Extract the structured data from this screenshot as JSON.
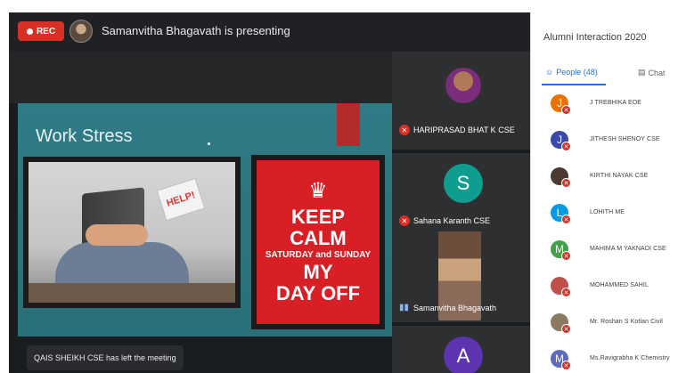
{
  "recording": {
    "label": "REC",
    "presenter_text": "Samanvitha Bhagavath is presenting"
  },
  "slide": {
    "title": "Work Stress",
    "help_sign": "HELP!",
    "keep_calm": {
      "line1": "KEEP",
      "line2": "CALM",
      "line3": "SATURDAY and SUNDAY",
      "line4": "MY",
      "line5": "DAY OFF"
    }
  },
  "toast": {
    "text": "QAIS SHEIKH CSE has left the meeting"
  },
  "tiles": [
    {
      "name": "HARIPRASAD BHAT K CSE",
      "avatar": "photo"
    },
    {
      "name": "Sahana Karanth CSE",
      "avatar_letter": "S",
      "color": "#0f9d8f"
    },
    {
      "name": "Samanvitha Bhagavath",
      "avatar": "photo"
    },
    {
      "name": "",
      "avatar_letter": "A",
      "color": "#5e35b1"
    }
  ],
  "panel": {
    "title": "Alumni Interaction 2020",
    "tabs": {
      "people": "People (48)",
      "chat": "Chat"
    },
    "participants": [
      {
        "letter": "J",
        "name": "J TREBHIKA EOE",
        "color": "#e8710a"
      },
      {
        "letter": "J",
        "name": "JITHESH SHENOY CSE",
        "color": "#3949ab"
      },
      {
        "letter": "",
        "name": "KIRTHI NAYAK CSE",
        "color": "#4a3a30"
      },
      {
        "letter": "L",
        "name": "LOHITH ME",
        "color": "#039be5"
      },
      {
        "letter": "M",
        "name": "MAHIMA M YAKNADI CSE",
        "color": "#43a047"
      },
      {
        "letter": "",
        "name": "MOHAMMED SAHIL",
        "color": "#c0504a"
      },
      {
        "letter": "",
        "name": "Mr. Roshan S Kotian Civil",
        "color": "#8a7a60"
      },
      {
        "letter": "M",
        "name": "Ms.Ravigrabha K Chemistry",
        "color": "#5c6bc0"
      }
    ]
  },
  "colors": {
    "rec": "#d93025",
    "accent": "#1a73e8",
    "slide_bg": "#2f7b86",
    "keep_calm": "#d81f26"
  }
}
